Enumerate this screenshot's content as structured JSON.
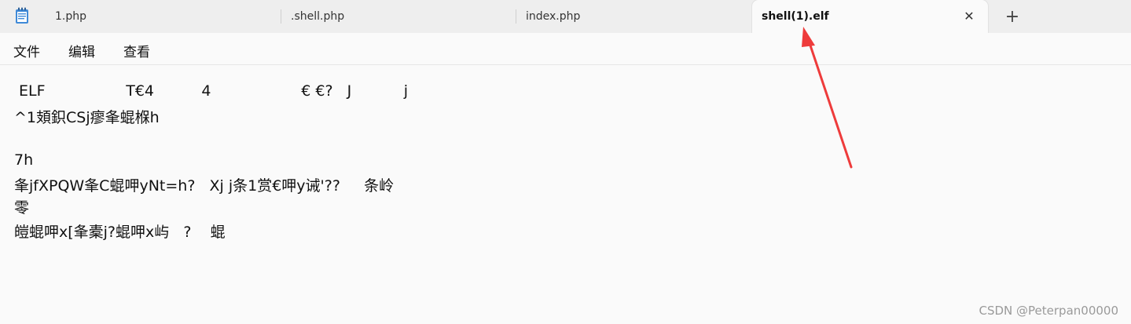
{
  "tabs": [
    {
      "label": "1.php",
      "active": false
    },
    {
      "label": ".shell.php",
      "active": false
    },
    {
      "label": "index.php",
      "active": false
    },
    {
      "label": "shell(1).elf",
      "active": true
    }
  ],
  "tab_close_icon": "close-icon",
  "new_tab_icon": "plus-icon",
  "new_tab_glyph": "+",
  "close_glyph": "✕",
  "menu": [
    "文件",
    "编辑",
    "查看"
  ],
  "content_lines": [
    " ELF\u0001\u0001\u0001         \u0001  \u0001  \u0001    T€\u0004\b4          4   \u0001       \u0001         €\u0004\b €\u0004\b?   J\u0001        \u0001   j",
    "^1頍鉙CSj\u0002瘳夆蜫椺h",
    "",
    "7\u0001h\u0002",
    "\u0002夆jfXPQW夆C蜫呷y\u0001Nt=h?   Xj j\u0002条1赏€呷y诫'??  \u0002   条岭",
    "零",
    "皚蜫呷x\u0001[夆橐j?蜫呷x\u0001\u0001屿\u0003   ?    蜫"
  ],
  "watermark": "CSDN @Peterpan00000",
  "colors": {
    "arrow": "#ee3b3b",
    "accent": "#1a73e8"
  }
}
